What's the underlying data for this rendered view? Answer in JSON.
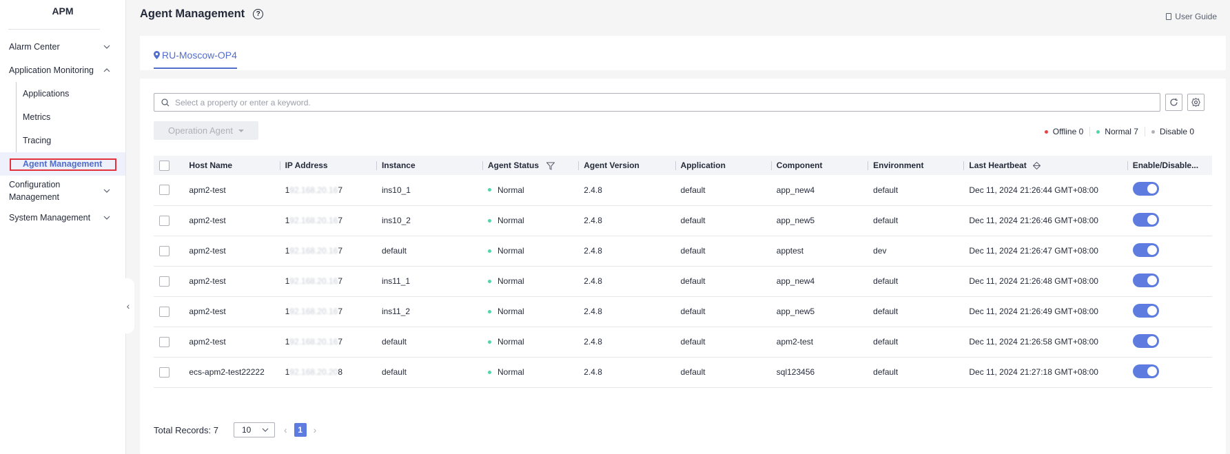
{
  "app": {
    "title": "APM"
  },
  "sidebar": {
    "items": [
      {
        "label": "Alarm Center",
        "expanded": false
      },
      {
        "label": "Application Monitoring",
        "expanded": true,
        "children": [
          {
            "label": "Applications"
          },
          {
            "label": "Metrics"
          },
          {
            "label": "Tracing"
          },
          {
            "label": "Agent Management",
            "active": true
          }
        ]
      },
      {
        "label": "Configuration Management",
        "label_line1": "Configuration",
        "label_line2": "Management",
        "expanded": false
      },
      {
        "label": "System Management",
        "expanded": false
      }
    ],
    "collapse_glyph": "‹"
  },
  "header": {
    "title": "Agent Management",
    "help_glyph": "?",
    "user_guide": "User Guide"
  },
  "region": {
    "tab": "RU-Moscow-OP4"
  },
  "search": {
    "placeholder": "Select a property or enter a keyword."
  },
  "toolbar": {
    "operation_agent": "Operation Agent"
  },
  "legend": [
    {
      "label": "Offline 0",
      "color": "#e54545"
    },
    {
      "label": "Normal 7",
      "color": "#50d4ab"
    },
    {
      "label": "Disable 0",
      "color": "#adb0b8"
    }
  ],
  "table": {
    "headers": [
      "Host Name",
      "IP Address",
      "Instance",
      "Agent Status",
      "Agent Version",
      "Application",
      "Component",
      "Environment",
      "Last Heartbeat",
      "Enable/Disable..."
    ],
    "rows": [
      {
        "host": "apm2-test",
        "ip_first": "1",
        "ip_mid": "92.168.20.16",
        "ip_last": "7",
        "instance": "ins10_1",
        "status": "Normal",
        "version": "2.4.8",
        "application": "default",
        "component": "app_new4",
        "environment": "default",
        "heartbeat": "Dec 11, 2024 21:26:44 GMT+08:00",
        "enabled": true
      },
      {
        "host": "apm2-test",
        "ip_first": "1",
        "ip_mid": "92.168.20.16",
        "ip_last": "7",
        "instance": "ins10_2",
        "status": "Normal",
        "version": "2.4.8",
        "application": "default",
        "component": "app_new5",
        "environment": "default",
        "heartbeat": "Dec 11, 2024 21:26:46 GMT+08:00",
        "enabled": true
      },
      {
        "host": "apm2-test",
        "ip_first": "1",
        "ip_mid": "92.168.20.16",
        "ip_last": "7",
        "instance": "default",
        "status": "Normal",
        "version": "2.4.8",
        "application": "default",
        "component": "apptest",
        "environment": "dev",
        "heartbeat": "Dec 11, 2024 21:26:47 GMT+08:00",
        "enabled": true
      },
      {
        "host": "apm2-test",
        "ip_first": "1",
        "ip_mid": "92.168.20.16",
        "ip_last": "7",
        "instance": "ins11_1",
        "status": "Normal",
        "version": "2.4.8",
        "application": "default",
        "component": "app_new4",
        "environment": "default",
        "heartbeat": "Dec 11, 2024 21:26:48 GMT+08:00",
        "enabled": true
      },
      {
        "host": "apm2-test",
        "ip_first": "1",
        "ip_mid": "92.168.20.16",
        "ip_last": "7",
        "instance": "ins11_2",
        "status": "Normal",
        "version": "2.4.8",
        "application": "default",
        "component": "app_new5",
        "environment": "default",
        "heartbeat": "Dec 11, 2024 21:26:49 GMT+08:00",
        "enabled": true
      },
      {
        "host": "apm2-test",
        "ip_first": "1",
        "ip_mid": "92.168.20.16",
        "ip_last": "7",
        "instance": "default",
        "status": "Normal",
        "version": "2.4.8",
        "application": "default",
        "component": "apm2-test",
        "environment": "default",
        "heartbeat": "Dec 11, 2024 21:26:58 GMT+08:00",
        "enabled": true
      },
      {
        "host": "ecs-apm2-test22222",
        "ip_first": "1",
        "ip_mid": "92.168.20.20",
        "ip_last": "8",
        "instance": "default",
        "status": "Normal",
        "version": "2.4.8",
        "application": "default",
        "component": "sql123456",
        "environment": "default",
        "heartbeat": "Dec 11, 2024 21:27:18 GMT+08:00",
        "enabled": true
      }
    ],
    "status_color": "#50d4ab"
  },
  "footer": {
    "total": "Total Records: 7",
    "page_size": "10",
    "current_page": "1"
  },
  "colors": {
    "accent": "#526ecc",
    "toggle_on": "#5e7ce0"
  }
}
